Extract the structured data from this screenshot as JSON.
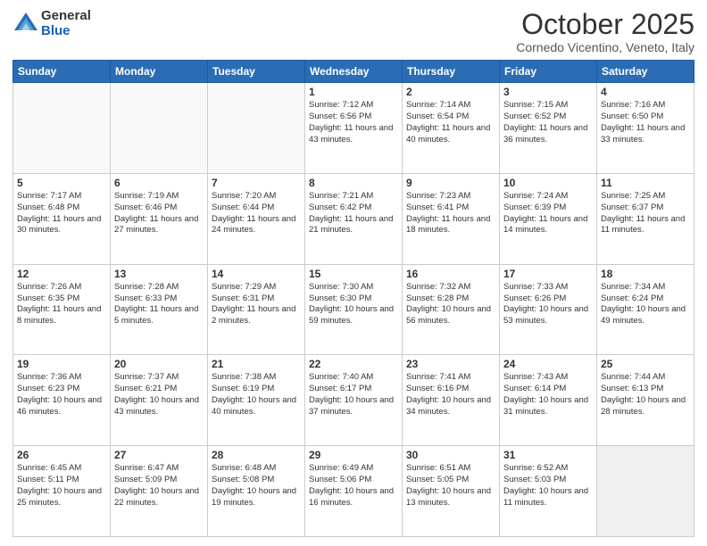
{
  "logo": {
    "general": "General",
    "blue": "Blue"
  },
  "header": {
    "month": "October 2025",
    "location": "Cornedo Vicentino, Veneto, Italy"
  },
  "days_of_week": [
    "Sunday",
    "Monday",
    "Tuesday",
    "Wednesday",
    "Thursday",
    "Friday",
    "Saturday"
  ],
  "weeks": [
    [
      {
        "day": "",
        "info": ""
      },
      {
        "day": "",
        "info": ""
      },
      {
        "day": "",
        "info": ""
      },
      {
        "day": "1",
        "info": "Sunrise: 7:12 AM\nSunset: 6:56 PM\nDaylight: 11 hours and 43 minutes."
      },
      {
        "day": "2",
        "info": "Sunrise: 7:14 AM\nSunset: 6:54 PM\nDaylight: 11 hours and 40 minutes."
      },
      {
        "day": "3",
        "info": "Sunrise: 7:15 AM\nSunset: 6:52 PM\nDaylight: 11 hours and 36 minutes."
      },
      {
        "day": "4",
        "info": "Sunrise: 7:16 AM\nSunset: 6:50 PM\nDaylight: 11 hours and 33 minutes."
      }
    ],
    [
      {
        "day": "5",
        "info": "Sunrise: 7:17 AM\nSunset: 6:48 PM\nDaylight: 11 hours and 30 minutes."
      },
      {
        "day": "6",
        "info": "Sunrise: 7:19 AM\nSunset: 6:46 PM\nDaylight: 11 hours and 27 minutes."
      },
      {
        "day": "7",
        "info": "Sunrise: 7:20 AM\nSunset: 6:44 PM\nDaylight: 11 hours and 24 minutes."
      },
      {
        "day": "8",
        "info": "Sunrise: 7:21 AM\nSunset: 6:42 PM\nDaylight: 11 hours and 21 minutes."
      },
      {
        "day": "9",
        "info": "Sunrise: 7:23 AM\nSunset: 6:41 PM\nDaylight: 11 hours and 18 minutes."
      },
      {
        "day": "10",
        "info": "Sunrise: 7:24 AM\nSunset: 6:39 PM\nDaylight: 11 hours and 14 minutes."
      },
      {
        "day": "11",
        "info": "Sunrise: 7:25 AM\nSunset: 6:37 PM\nDaylight: 11 hours and 11 minutes."
      }
    ],
    [
      {
        "day": "12",
        "info": "Sunrise: 7:26 AM\nSunset: 6:35 PM\nDaylight: 11 hours and 8 minutes."
      },
      {
        "day": "13",
        "info": "Sunrise: 7:28 AM\nSunset: 6:33 PM\nDaylight: 11 hours and 5 minutes."
      },
      {
        "day": "14",
        "info": "Sunrise: 7:29 AM\nSunset: 6:31 PM\nDaylight: 11 hours and 2 minutes."
      },
      {
        "day": "15",
        "info": "Sunrise: 7:30 AM\nSunset: 6:30 PM\nDaylight: 10 hours and 59 minutes."
      },
      {
        "day": "16",
        "info": "Sunrise: 7:32 AM\nSunset: 6:28 PM\nDaylight: 10 hours and 56 minutes."
      },
      {
        "day": "17",
        "info": "Sunrise: 7:33 AM\nSunset: 6:26 PM\nDaylight: 10 hours and 53 minutes."
      },
      {
        "day": "18",
        "info": "Sunrise: 7:34 AM\nSunset: 6:24 PM\nDaylight: 10 hours and 49 minutes."
      }
    ],
    [
      {
        "day": "19",
        "info": "Sunrise: 7:36 AM\nSunset: 6:23 PM\nDaylight: 10 hours and 46 minutes."
      },
      {
        "day": "20",
        "info": "Sunrise: 7:37 AM\nSunset: 6:21 PM\nDaylight: 10 hours and 43 minutes."
      },
      {
        "day": "21",
        "info": "Sunrise: 7:38 AM\nSunset: 6:19 PM\nDaylight: 10 hours and 40 minutes."
      },
      {
        "day": "22",
        "info": "Sunrise: 7:40 AM\nSunset: 6:17 PM\nDaylight: 10 hours and 37 minutes."
      },
      {
        "day": "23",
        "info": "Sunrise: 7:41 AM\nSunset: 6:16 PM\nDaylight: 10 hours and 34 minutes."
      },
      {
        "day": "24",
        "info": "Sunrise: 7:43 AM\nSunset: 6:14 PM\nDaylight: 10 hours and 31 minutes."
      },
      {
        "day": "25",
        "info": "Sunrise: 7:44 AM\nSunset: 6:13 PM\nDaylight: 10 hours and 28 minutes."
      }
    ],
    [
      {
        "day": "26",
        "info": "Sunrise: 6:45 AM\nSunset: 5:11 PM\nDaylight: 10 hours and 25 minutes."
      },
      {
        "day": "27",
        "info": "Sunrise: 6:47 AM\nSunset: 5:09 PM\nDaylight: 10 hours and 22 minutes."
      },
      {
        "day": "28",
        "info": "Sunrise: 6:48 AM\nSunset: 5:08 PM\nDaylight: 10 hours and 19 minutes."
      },
      {
        "day": "29",
        "info": "Sunrise: 6:49 AM\nSunset: 5:06 PM\nDaylight: 10 hours and 16 minutes."
      },
      {
        "day": "30",
        "info": "Sunrise: 6:51 AM\nSunset: 5:05 PM\nDaylight: 10 hours and 13 minutes."
      },
      {
        "day": "31",
        "info": "Sunrise: 6:52 AM\nSunset: 5:03 PM\nDaylight: 10 hours and 11 minutes."
      },
      {
        "day": "",
        "info": ""
      }
    ]
  ]
}
